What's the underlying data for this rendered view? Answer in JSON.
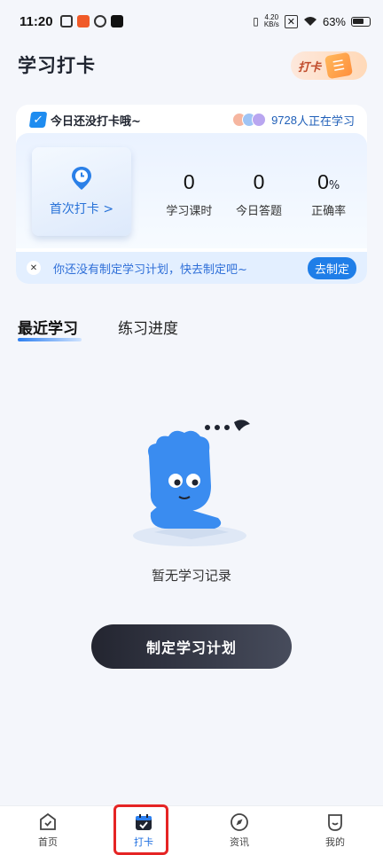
{
  "status_bar": {
    "time": "11:20",
    "net_speed_value": "4.20",
    "net_speed_unit": "KB/s",
    "battery": "63%"
  },
  "header": {
    "title": "学习打卡",
    "badge_text": "打卡"
  },
  "card": {
    "status_text": "今日还没打卡哦~",
    "learners_count": "9728",
    "learners_suffix": "人正在学习",
    "first_checkin": "首次打卡 >",
    "stats": [
      {
        "value": "0",
        "unit": "",
        "label": "学习课时"
      },
      {
        "value": "0",
        "unit": "",
        "label": "今日答题"
      },
      {
        "value": "0",
        "unit": "%",
        "label": "正确率"
      }
    ],
    "plan_text": "你还没有制定学习计划，快去制定吧~",
    "plan_button": "去制定"
  },
  "tabs": [
    {
      "label": "最近学习",
      "active": true
    },
    {
      "label": "练习进度",
      "active": false
    }
  ],
  "empty_state": {
    "text": "暂无学习记录",
    "button": "制定学习计划"
  },
  "bottom_nav": [
    {
      "label": "首页",
      "icon": "home-icon"
    },
    {
      "label": "打卡",
      "icon": "calendar-icon",
      "active": true
    },
    {
      "label": "资讯",
      "icon": "compass-icon"
    },
    {
      "label": "我的",
      "icon": "profile-icon"
    }
  ],
  "colors": {
    "accent": "#1f7ee8",
    "dark_button": "#232530",
    "highlight": "#e52424"
  }
}
